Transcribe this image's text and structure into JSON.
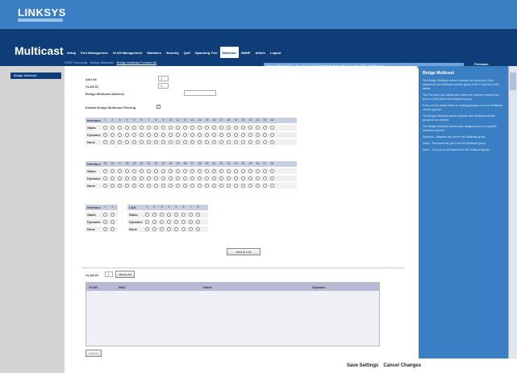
{
  "brand": {
    "logo": "LINKSYS"
  },
  "header": {
    "section_title": "Multicast",
    "info_text": "Model SRW248G4 | Port 48 10/100 Gigabit Switch with 4 Combo SFP 1000Base-T",
    "firmware": "Firmware"
  },
  "tabs": [
    {
      "label": "Setup"
    },
    {
      "label": "Port Management"
    },
    {
      "label": "VLAN Management"
    },
    {
      "label": "Statistics"
    },
    {
      "label": "Security"
    },
    {
      "label": "QoS"
    },
    {
      "label": "Spanning Tree"
    },
    {
      "label": "Multicast"
    },
    {
      "label": "SNMP"
    },
    {
      "label": "Admin"
    },
    {
      "label": "Logout"
    }
  ],
  "subtabs": [
    "IGMP Snooping",
    "Bridge Multicast",
    "Bridge Multicast Forward All"
  ],
  "leftnav": {
    "item": "Bridge Multicast"
  },
  "form": {
    "enable_label": "Add Ne",
    "vlan_label": "VLAN ID",
    "vlan_value": "1",
    "vlan2_value": "1",
    "address_label": "Bridge Multicast Address",
    "address_placeholder": "",
    "enable_bridge_label": "Enable Bridge Multicast Filtering",
    "row_interface": "Interface",
    "row_static": "Static",
    "row_dynamic": "Dynamic",
    "row_none": "None",
    "row_lag": "LAG",
    "ports_a": [
      "1",
      "2",
      "3",
      "4",
      "5",
      "6",
      "7",
      "8",
      "9",
      "10",
      "11",
      "12",
      "13",
      "14",
      "15",
      "16",
      "17",
      "18",
      "19",
      "20",
      "21",
      "22",
      "23",
      "24"
    ],
    "ports_b": [
      "25",
      "26",
      "27",
      "28",
      "29",
      "30",
      "31",
      "32",
      "33",
      "34",
      "35",
      "36",
      "37",
      "38",
      "39",
      "40",
      "41",
      "42",
      "43",
      "44",
      "45",
      "46",
      "47",
      "48"
    ],
    "gbic": [
      "1",
      "2"
    ],
    "lags": [
      "1",
      "2",
      "3",
      "4",
      "5",
      "6",
      "7",
      "8"
    ],
    "add_button": "Add to List"
  },
  "list": {
    "vlan_label": "VLAN ID",
    "vlan_value": "1",
    "show_all": "Show All",
    "columns": [
      "VLAN",
      "MAC",
      "Name",
      "Dynamic"
    ],
    "delete_button": "Delete"
  },
  "help": {
    "title": "Bridge Multicast",
    "paragraphs": [
      "The Bridge Multicast screen displays the ports and LAGs attached to the Multicast service group in the Ports and LAGs tables.",
      "The Port and LAG tables also reflect the manner in which the port or LAGs joined the Multicast group.",
      "Ports can be added either to existing groups or to new Multicast service groups.",
      "The Bridge Multicast screen permits new Multicast service groups to be created.",
      "The Bridge Multicast screen also assigns ports to a specific Multicast address.",
      "Dynamic - Attaches the port to the Multicast group.",
      "Static - Removes the port from the Multicast group.",
      "None - The port is not attached to the Multicast group."
    ]
  },
  "footer": {
    "save": "Save Settings",
    "cancel": "Cancel Changes"
  },
  "colors": {
    "brand_blue": "#3a7fc4",
    "nav_navy": "#0e3d78"
  }
}
